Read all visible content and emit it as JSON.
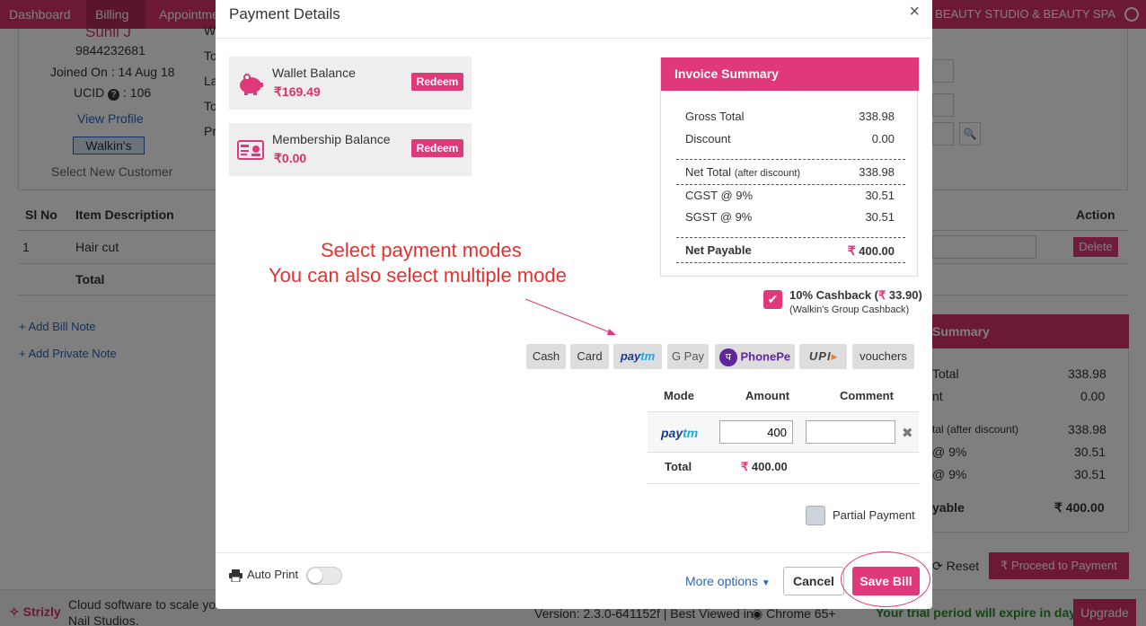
{
  "nav": {
    "tabs": [
      "Dashboard",
      "Billing",
      "Appointme"
    ],
    "studio_name": "BEAUTY STUDIO & BEAUTY SPA"
  },
  "background": {
    "customer": {
      "name": "Sunil J",
      "phone": "9844232681",
      "joined": "Joined On : 14 Aug 18",
      "ucid": "UCID",
      "ucid_value": ": 106",
      "view_profile": "View Profile",
      "badge": "Walkin's",
      "select_new": "Select New Customer"
    },
    "side_letters": [
      "W",
      "To",
      "La",
      "To",
      "Pr"
    ],
    "table": {
      "headers": [
        "Sl No",
        "Item Description",
        "Action"
      ],
      "row": {
        "sl": "1",
        "item": "Hair cut",
        "action": "Delete"
      },
      "total_label": "Total"
    },
    "add_bill_note": "+ Add Bill Note",
    "add_private_note": "+ Add Private Note",
    "summary": {
      "head": "Summary",
      "rows": [
        {
          "label": "Total",
          "value": "338.98"
        },
        {
          "label": "nt",
          "value": "0.00"
        },
        {
          "label": "tal (after discount)",
          "value": "338.98"
        },
        {
          "label": "@ 9%",
          "value": "30.51"
        },
        {
          "label": "@ 9%",
          "value": "30.51"
        },
        {
          "label": "yable",
          "value": "400.00"
        }
      ]
    },
    "reset": "Reset",
    "proceed": "Proceed to Payment",
    "footer": {
      "brand": "Strizly",
      "tagline1": "Cloud software to scale you",
      "tagline2": "Nail Studios.",
      "version": "Version: 2.3.0-641152f | Best Viewed in",
      "browser": "Chrome 65+",
      "trial": "Your trial period will expire in days",
      "upgrade": "Upgrade"
    }
  },
  "modal": {
    "title": "Payment Details",
    "close": "×",
    "wallet": {
      "title": "Wallet Balance",
      "amount": "169.49",
      "redeem": "Redeem"
    },
    "membership": {
      "title": "Membership Balance",
      "amount": "0.00",
      "redeem": "Redeem"
    },
    "annotation_line1": "Select payment modes",
    "annotation_line2": "You can also select multiple mode",
    "invoice": {
      "head": "Invoice Summary",
      "gross_total": {
        "label": "Gross Total",
        "value": "338.98"
      },
      "discount": {
        "label": "Discount",
        "value": "0.00"
      },
      "net_total": {
        "label": "Net Total",
        "sub": "(after discount)",
        "value": "338.98"
      },
      "cgst": {
        "label": "CGST @ 9%",
        "value": "30.51"
      },
      "sgst": {
        "label": "SGST @ 9%",
        "value": "30.51"
      },
      "net_payable": {
        "label": "Net Payable",
        "value": "400.00"
      }
    },
    "cashback": {
      "checked": true,
      "title": "10% Cashback (",
      "amount": "33.90",
      "close_paren": ")",
      "sub": "(Walkin's Group Cashback)"
    },
    "modes": [
      "Cash",
      "Card",
      "Paytm",
      "G Pay",
      "PhonePe",
      "UPI",
      "vouchers"
    ],
    "payment_table": {
      "headers": [
        "Mode",
        "Amount",
        "Comment"
      ],
      "row_mode": "Paytm",
      "amount_value": "400",
      "comment_value": "",
      "total_label": "Total",
      "total_value": "400.00"
    },
    "partial_payment": "Partial Payment",
    "auto_print": "Auto Print",
    "more_options": "More options",
    "cancel": "Cancel",
    "save": "Save Bill"
  },
  "colors": {
    "brand": "#e0397a",
    "nav": "#d6336c",
    "link": "#2b66b8",
    "annotation": "#e8302f"
  }
}
